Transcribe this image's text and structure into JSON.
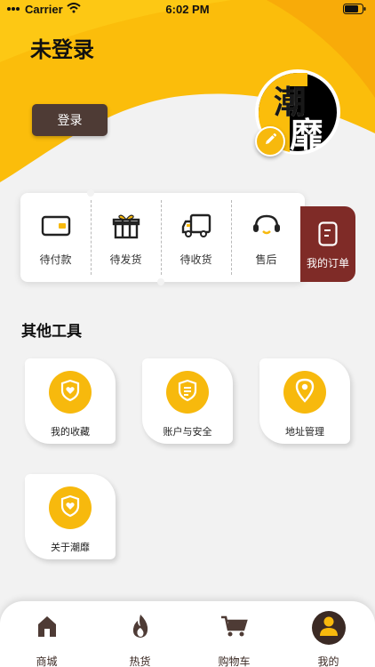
{
  "status_bar": {
    "carrier": "Carrier",
    "time": "6:02 PM"
  },
  "header": {
    "title": "未登录",
    "login_label": "登录"
  },
  "avatar": {
    "badge_text": "潮靡"
  },
  "orders": {
    "items": [
      {
        "label": "待付款",
        "icon": "wallet-icon"
      },
      {
        "label": "待发货",
        "icon": "gift-box-icon"
      },
      {
        "label": "待收货",
        "icon": "delivery-truck-icon"
      },
      {
        "label": "售后",
        "icon": "headset-icon"
      }
    ],
    "all_label": "我的订单"
  },
  "tools": {
    "title": "其他工具",
    "items": [
      {
        "label": "我的收藏",
        "icon": "heart-shield-icon"
      },
      {
        "label": "账户与安全",
        "icon": "shield-document-icon"
      },
      {
        "label": "地址管理",
        "icon": "map-pin-icon"
      },
      {
        "label": "关于潮靡",
        "icon": "heart-shield-icon"
      }
    ]
  },
  "tabbar": {
    "items": [
      {
        "label": "商城",
        "icon": "home-icon"
      },
      {
        "label": "热货",
        "icon": "flame-icon"
      },
      {
        "label": "购物车",
        "icon": "cart-icon"
      },
      {
        "label": "我的",
        "icon": "user-icon",
        "active": true
      }
    ]
  },
  "colors": {
    "accent": "#f7b90d",
    "brown": "#4e3b35",
    "maroon": "#7f2b27",
    "background": "#f2f2f2"
  }
}
